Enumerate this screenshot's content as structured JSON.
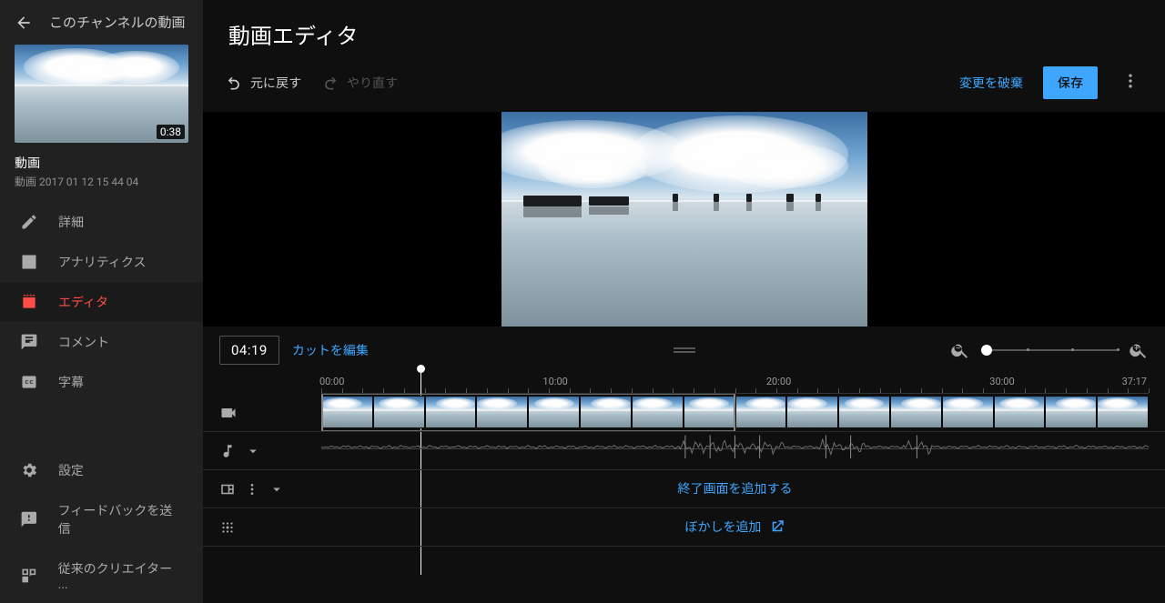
{
  "sidebar": {
    "back_label": "このチャンネルの動画",
    "thumb_duration": "0:38",
    "video_label": "動画",
    "video_name": "動画 2017 01 12 15 44 04",
    "nav": [
      {
        "icon": "pencil",
        "label": "詳細"
      },
      {
        "icon": "chart",
        "label": "アナリティクス"
      },
      {
        "icon": "editor",
        "label": "エディタ"
      },
      {
        "icon": "comment",
        "label": "コメント"
      },
      {
        "icon": "cc",
        "label": "字幕"
      }
    ],
    "bottom": [
      {
        "icon": "gear",
        "label": "設定"
      },
      {
        "icon": "feedback",
        "label": "フィードバックを送信"
      },
      {
        "icon": "classic",
        "label": "従来のクリエイター ..."
      }
    ]
  },
  "page": {
    "title": "動画エディタ"
  },
  "toolbar": {
    "undo": "元に戻す",
    "redo": "やり直す",
    "discard": "変更を破棄",
    "save": "保存"
  },
  "timeline": {
    "current_time": "04:19",
    "edit_cut": "カットを編集",
    "marks": [
      "00:00",
      "10:00",
      "20:00",
      "30:00",
      "37:17"
    ],
    "mark_pos": [
      0,
      27,
      54,
      81,
      100
    ],
    "playhead_pct": 12.0,
    "selection_pct": 50.0,
    "end_screen_label": "終了画面を追加する",
    "blur_label": "ぼかしを追加"
  }
}
